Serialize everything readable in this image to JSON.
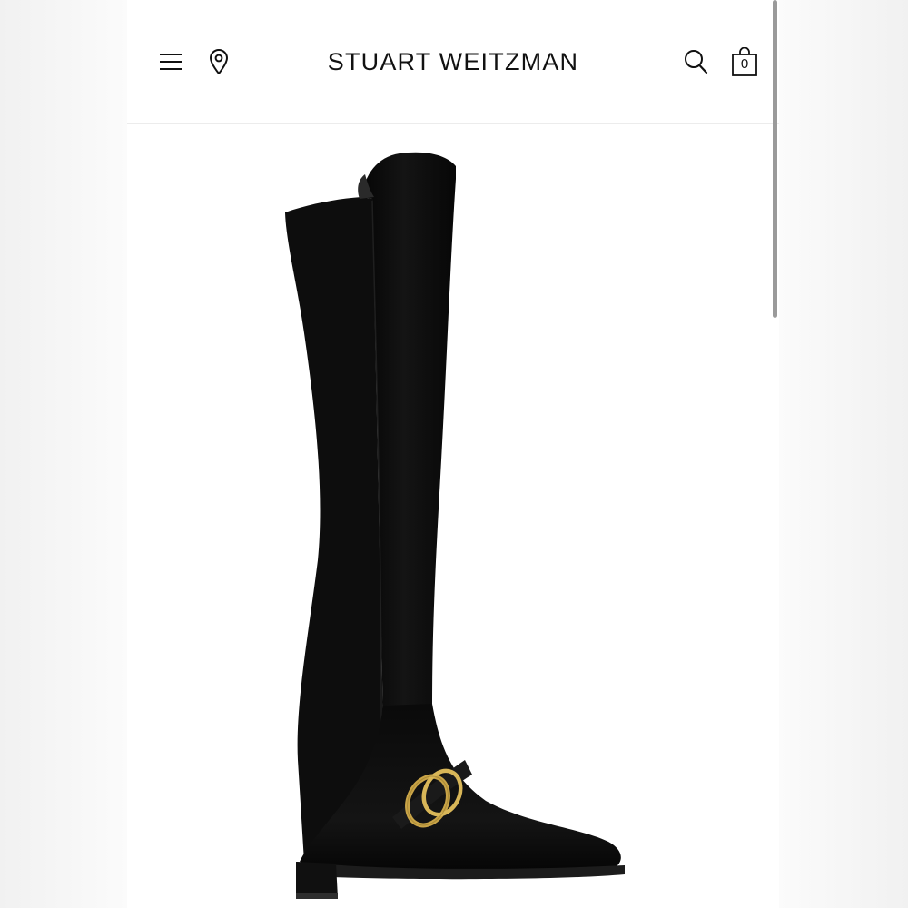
{
  "header": {
    "brand": "STUART WEITZMAN",
    "bag_count": "0",
    "icons": {
      "menu": "hamburger-menu-icon",
      "location": "map-pin-icon",
      "search": "search-icon",
      "bag": "shopping-bag-icon"
    }
  },
  "product": {
    "image_description": "black suede over-the-knee boot with gold buckle"
  },
  "colors": {
    "boot": "#0c0c0c",
    "buckle": "#c9a447",
    "header_bg": "#ffffff",
    "text": "#111111"
  }
}
